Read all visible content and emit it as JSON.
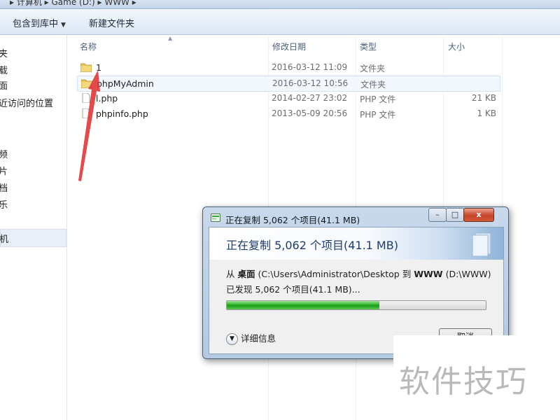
{
  "addressbar": {
    "path": "▸ 计算机 ▸ Game (D:) ▸ WWW ▸"
  },
  "toolbar": {
    "include_library": "包含到库中",
    "new_folder": "新建文件夹"
  },
  "navpane": {
    "items": [
      "夹",
      "载",
      "面",
      "近访问的位置",
      "频",
      "片",
      "档",
      "乐",
      "机"
    ],
    "selected_index": 8
  },
  "filelist": {
    "headers": {
      "name": "名称",
      "date": "修改日期",
      "type": "类型",
      "size": "大小"
    },
    "rows": [
      {
        "name": "1",
        "date": "2016-03-12 11:09",
        "type": "文件夹",
        "size": "",
        "icon": "folder-icon"
      },
      {
        "name": "phpMyAdmin",
        "date": "2016-03-12 10:56",
        "type": "文件夹",
        "size": "",
        "icon": "folder-icon"
      },
      {
        "name": "l.php",
        "date": "2014-02-27 23:02",
        "type": "PHP 文件",
        "size": "21 KB",
        "icon": "file-icon"
      },
      {
        "name": "phpinfo.php",
        "date": "2013-05-09 20:56",
        "type": "PHP 文件",
        "size": "1 KB",
        "icon": "file-icon"
      }
    ]
  },
  "dialog": {
    "title": "正在复制 5,062 个项目(41.1 MB)",
    "heading": "正在复制 5,062 个项目(41.1 MB)",
    "from_label": "从",
    "from_name": "桌面",
    "from_path": "(C:\\Users\\Administrator\\Desktop",
    "to_label": "到",
    "to_name": "WWW",
    "to_path": "(D:\\WWW)",
    "found": "已发现 5,062 个项目(41.1 MB)...",
    "progress_percent": 59,
    "details": "详细信息",
    "cancel": "取消",
    "window_buttons": {
      "minimize": "–",
      "maximize": "□",
      "close": "x"
    }
  },
  "watermark": "软件技巧",
  "colors": {
    "progress_green": "#27b324",
    "annotation_red": "#e23b3b",
    "toolbar_bg": "#e4edf8"
  }
}
